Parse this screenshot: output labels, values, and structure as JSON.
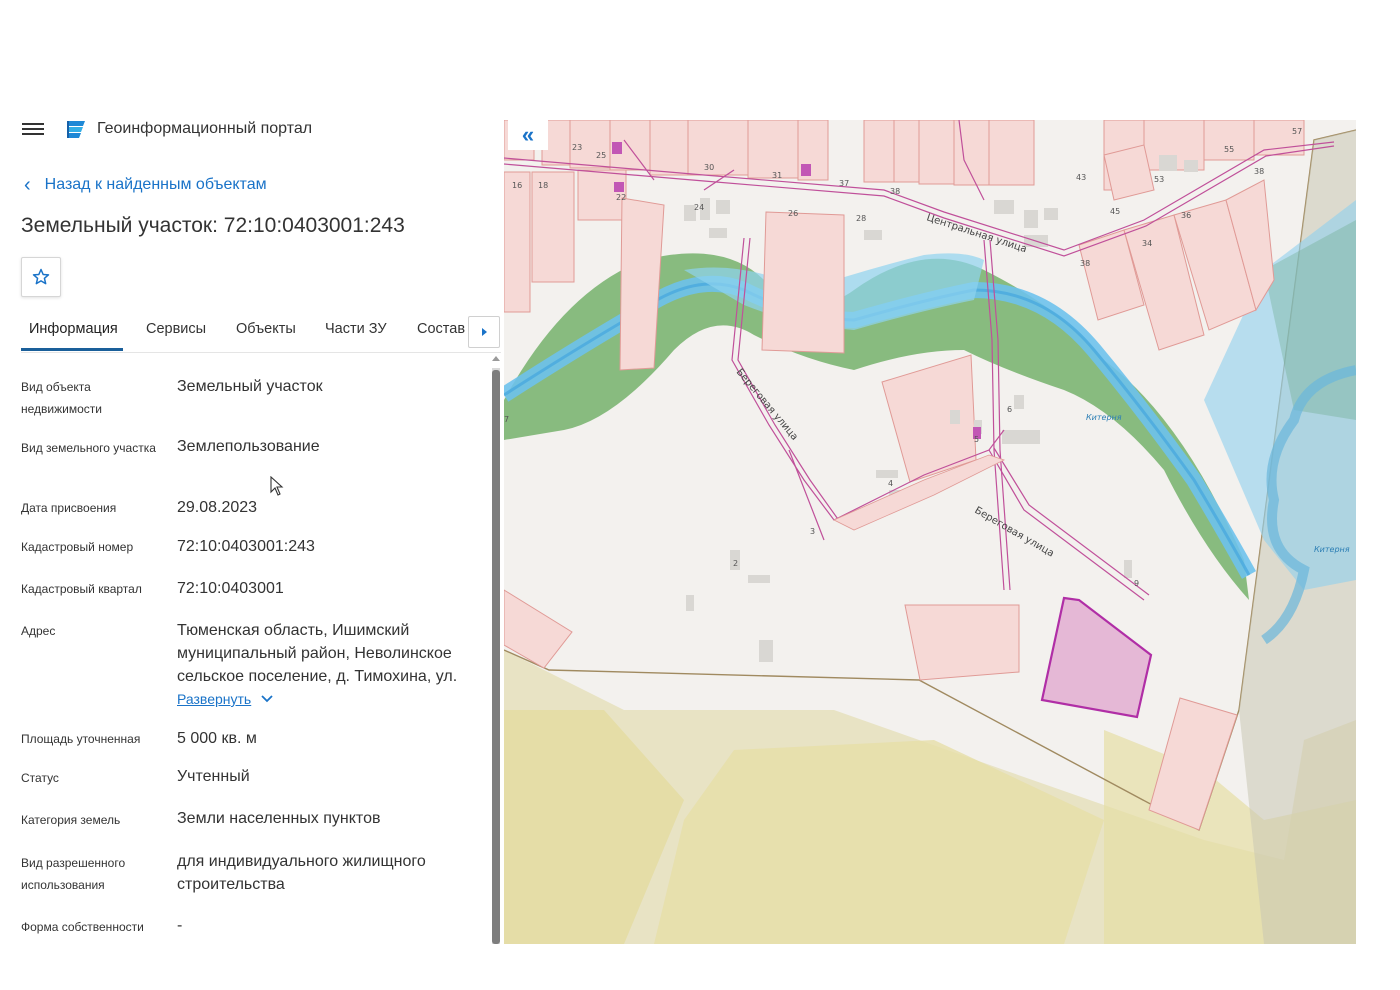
{
  "app": {
    "title": "Геоинформационный портал"
  },
  "nav": {
    "back_label": "Назад к найденным объектам"
  },
  "page": {
    "title": "Земельный участок: 72:10:0403001:243"
  },
  "tabs": [
    {
      "label": "Информация",
      "active": true
    },
    {
      "label": "Сервисы"
    },
    {
      "label": "Объекты"
    },
    {
      "label": "Части ЗУ"
    },
    {
      "label": "Состав"
    }
  ],
  "properties": [
    {
      "label": "Вид объекта недвижимости",
      "value": "Земельный участок"
    },
    {
      "label": "Вид земельного участка",
      "value": "Землепользование"
    },
    {
      "label": "Дата присвоения",
      "value": "29.08.2023"
    },
    {
      "label": "Кадастровый номер",
      "value": "72:10:0403001:243"
    },
    {
      "label": "Кадастровый квартал",
      "value": "72:10:0403001"
    },
    {
      "label": "Адрес",
      "value": "Тюменская область, Ишимский муниципальный район, Неволинское сельское поселение, д. Тимохина, ул."
    },
    {
      "label": "Площадь уточненная",
      "value": "5 000 кв. м"
    },
    {
      "label": "Статус",
      "value": "Учтенный"
    },
    {
      "label": "Категория земель",
      "value": "Земли населенных пунктов"
    },
    {
      "label": "Вид разрешенного использования",
      "value": "для индивидуального жилищного строительства"
    },
    {
      "label": "Форма собственности",
      "value": "-"
    }
  ],
  "address_expand": {
    "label": "Развернуть"
  },
  "map": {
    "streets": [
      "Центральная улица",
      "Береговая улица",
      "Береговая улица"
    ],
    "water": [
      "Китерня",
      "Китерня"
    ],
    "house_numbers": [
      "23",
      "25",
      "30",
      "31",
      "37",
      "38",
      "16",
      "18",
      "22",
      "24",
      "26",
      "28",
      "43",
      "45",
      "53",
      "55",
      "57",
      "38",
      "36",
      "34",
      "38",
      "6",
      "5",
      "4",
      "3",
      "2",
      "9",
      "7"
    ],
    "colors": {
      "parcel_fill": "#f6d9d6",
      "parcel_stroke": "#e09a96",
      "selected_fill": "#e5b8d6",
      "selected_stroke": "#b02ea6",
      "river": "#7ec8ee",
      "green": "#74b26b",
      "farmland": "#e4ddb0",
      "road": "#c0509a"
    }
  },
  "icons": {
    "menu": "hamburger-menu-icon",
    "logo": "portal-logo-icon",
    "back": "chevron-left-icon",
    "favorite": "star-outline-icon",
    "tab_next": "chevron-right-icon",
    "collapse": "double-chevron-left-icon",
    "expand": "chevron-down-icon"
  }
}
